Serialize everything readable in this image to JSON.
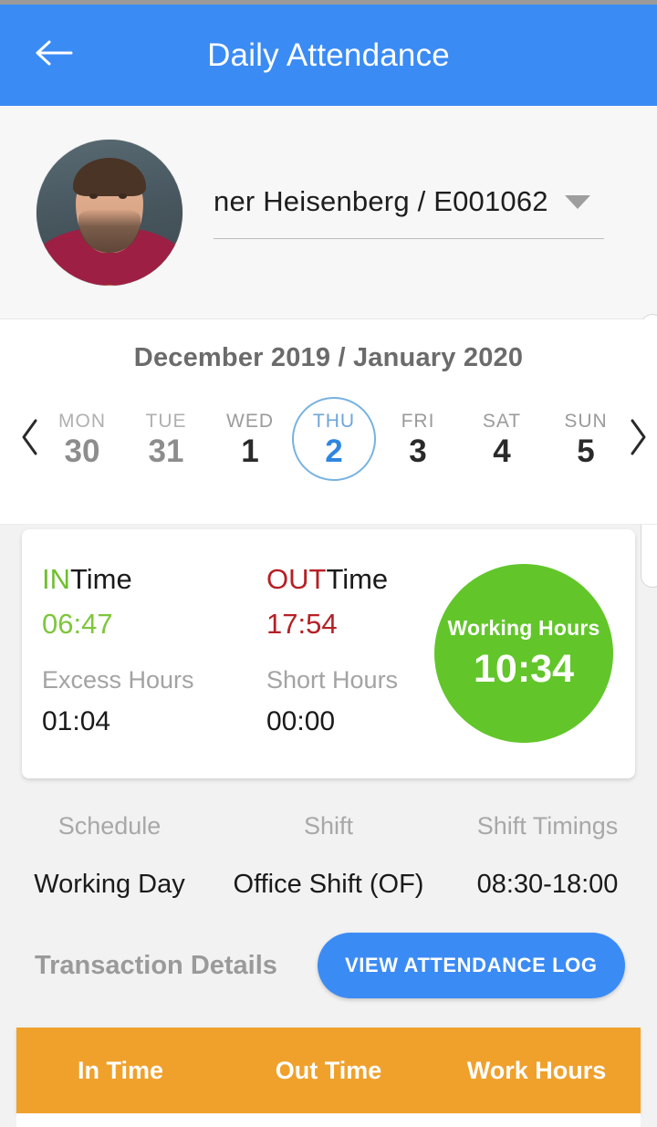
{
  "appbar": {
    "back_icon": "arrow-left-icon",
    "title": "Daily Attendance"
  },
  "employee": {
    "avatar_alt": "employee-photo",
    "name": "ner  Heisenberg / E001062",
    "dropdown_icon": "caret-down-icon"
  },
  "calendar": {
    "month_label": "December 2019 / January 2020",
    "prev_icon": "chevron-left-icon",
    "next_icon": "chevron-right-icon",
    "days": [
      {
        "dow": "MON",
        "num": "30",
        "state": "muted"
      },
      {
        "dow": "TUE",
        "num": "31",
        "state": "muted"
      },
      {
        "dow": "WED",
        "num": "1",
        "state": "normal"
      },
      {
        "dow": "THU",
        "num": "2",
        "state": "selected"
      },
      {
        "dow": "FRI",
        "num": "3",
        "state": "normal"
      },
      {
        "dow": "SAT",
        "num": "4",
        "state": "normal"
      },
      {
        "dow": "SUN",
        "num": "5",
        "state": "normal"
      }
    ]
  },
  "attendance": {
    "in_accent": "IN",
    "in_plain": "Time",
    "in_value": "06:47",
    "out_accent": "OUT",
    "out_plain": "Time",
    "out_value": "17:54",
    "excess_label": "Excess Hours",
    "excess_value": "01:04",
    "short_label": "Short Hours",
    "short_value": "00:00",
    "working_hours_label": "Working Hours",
    "working_hours_value": "10:34"
  },
  "schedule": {
    "columns": [
      {
        "head": "Schedule",
        "value": "Working Day"
      },
      {
        "head": "Shift",
        "value": "Office Shift (OF)"
      },
      {
        "head": "Shift Timings",
        "value": "08:30-18:00"
      }
    ]
  },
  "transaction": {
    "label": "Transaction Details",
    "button_label": "VIEW ATTENDANCE LOG"
  },
  "table": {
    "headers": [
      "In Time",
      "Out Time",
      "Work Hours"
    ]
  },
  "colors": {
    "primary_blue": "#3b8bf5",
    "green": "#62c62a",
    "in_green": "#7ec63c",
    "out_red": "#b52025",
    "orange": "#f0a12c",
    "selected_blue": "#2f86e0"
  }
}
